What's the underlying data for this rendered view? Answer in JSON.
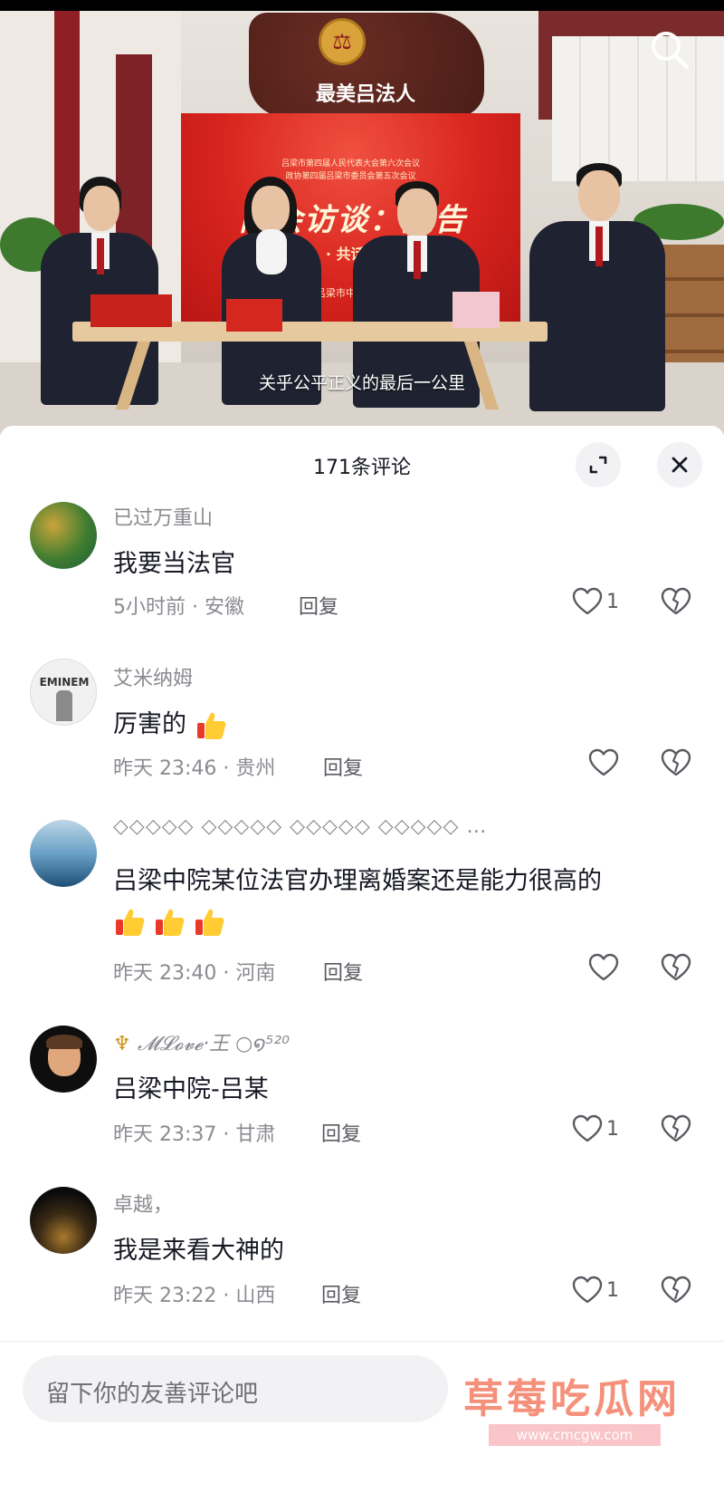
{
  "video": {
    "emblem_text": "最美吕法人",
    "backdrop_line1": "吕梁市第四届人民代表大会第六次会议",
    "backdrop_line2": "政协第四届吕梁市委员会第五次会议",
    "backdrop_slogan": "两会访谈：报告",
    "backdrop_sub": "· 共话 ·",
    "backdrop_org": "吕梁市中级人民",
    "caption": "关乎公平正义的最后一公里"
  },
  "panel": {
    "title": "171条评论"
  },
  "comments": [
    {
      "username": "已过万重山",
      "text": "我要当法官",
      "time_location": "5小时前 · 安徽",
      "reply_label": "回复",
      "like_count": "1"
    },
    {
      "username": "艾米纳姆",
      "text": "厉害的",
      "time_location": "昨天 23:46 · 贵州",
      "reply_label": "回复",
      "like_count": "",
      "avatar_text": "EMINEM"
    },
    {
      "username": "◇◇◇◇◇ ◇◇◇◇◇ ◇◇◇◇◇ ◇◇◇◇◇ …",
      "text": "吕梁中院某位法官办理离婚案还是能力很高的",
      "time_location": "昨天 23:40 · 河南",
      "reply_label": "回复",
      "like_count": ""
    },
    {
      "username": "𝓜𝓛𝓸𝓿𝓮·王 ○໑⁵²⁰",
      "text": "吕梁中院-吕某",
      "time_location": "昨天 23:37 · 甘肃",
      "reply_label": "回复",
      "like_count": "1"
    },
    {
      "username": "卓越，",
      "text": "我是来看大神的",
      "time_location": "昨天 23:22 · 山西",
      "reply_label": "回复",
      "like_count": "1"
    }
  ],
  "input": {
    "placeholder": "留下你的友善评论吧"
  },
  "watermark": {
    "text": "草莓吃瓜网",
    "url": "www.cmcgw.com"
  },
  "icons": {
    "search": "search-icon",
    "expand": "expand-icon",
    "close": "close-icon",
    "like": "heart-icon",
    "dislike": "broken-heart-icon",
    "thumbs": "thumbs-up-icon"
  },
  "colors": {
    "text_primary": "#161823",
    "text_secondary": "#8a8b91",
    "panel_bg": "#ffffff",
    "button_bg": "#f2f2f4"
  }
}
